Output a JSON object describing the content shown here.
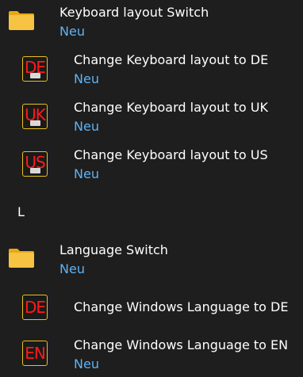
{
  "colors": {
    "background": "#1e1e1e",
    "text": "#ffffff",
    "accent": "#5fb3f5",
    "folder": "#f6c342",
    "icon_code": "#ff1a1a",
    "icon_border": "#e7c11b"
  },
  "groups": [
    {
      "title": "Keyboard layout Switch",
      "subtitle": "Neu",
      "icon": "folder-icon",
      "items": [
        {
          "code": "DE",
          "title": "Change Keyboard layout to DE",
          "subtitle": "Neu",
          "icon": "keyboard-flag-icon"
        },
        {
          "code": "UK",
          "title": "Change Keyboard layout to UK",
          "subtitle": "Neu",
          "icon": "keyboard-flag-icon"
        },
        {
          "code": "US",
          "title": "Change Keyboard layout to US",
          "subtitle": "Neu",
          "icon": "keyboard-flag-icon"
        }
      ]
    },
    {
      "letter_header": "L",
      "title": "Language Switch",
      "subtitle": "Neu",
      "icon": "folder-icon",
      "items": [
        {
          "code": "DE",
          "title": "Change Windows Language to DE",
          "subtitle": "",
          "icon": "language-code-icon"
        },
        {
          "code": "EN",
          "title": "Change Windows Language to EN",
          "subtitle": "Neu",
          "icon": "language-code-icon"
        }
      ]
    }
  ]
}
